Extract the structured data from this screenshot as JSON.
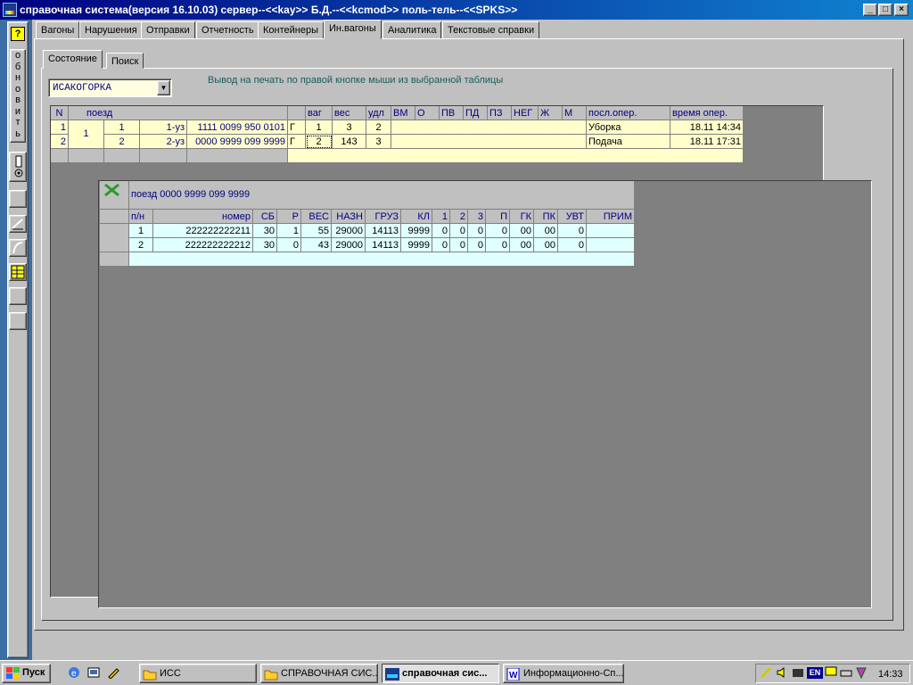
{
  "window": {
    "title": "справочная система(версия 16.10.03) сервер--<<kay>> Б.Д.--<<kcmod>> поль-тель--<<SPKS>>"
  },
  "leftbar": {
    "help": "?",
    "refresh_text": "о\nб\nн\nо\nв\nи\nт\nь"
  },
  "tabs": [
    "Вагоны",
    "Нарушения",
    "Отправки",
    "Отчетность",
    "Контейнеры",
    "Ин.вагоны",
    "Аналитика",
    "Текстовые справки"
  ],
  "subtabs": [
    "Состояние",
    "Поиск"
  ],
  "station": {
    "value": "ИСАКОГОРКА"
  },
  "hint": "Вывод на печать по правой кнопке мыши из выбранной таблицы",
  "grid1": {
    "headers": {
      "n": "N",
      "train": "поезд",
      "vag": "ваг",
      "ves": "вес",
      "udl": "удл",
      "vm": "ВМ",
      "o": "О",
      "pv": "ПВ",
      "pd": "ПД",
      "pz": "ПЗ",
      "neg": "НЕГ",
      "zh": "Ж",
      "m": "М",
      "posl": "посл.опер.",
      "time": "время опер."
    },
    "group": "1",
    "rows": [
      {
        "n": "1",
        "c1": "1",
        "c2": "1-уз",
        "index": "1111 0099 950 0101",
        "g": "Г",
        "vag": "1",
        "ves": "3",
        "udl": "2",
        "posl": "Уборка",
        "time": "18.11 14:34"
      },
      {
        "n": "2",
        "c1": "2",
        "c2": "2-уз",
        "index": "0000 9999 099 9999",
        "g": "Г",
        "vag": "2",
        "ves": "143",
        "udl": "3",
        "posl": "Подача",
        "time": "18.11 17:31"
      }
    ]
  },
  "grid2": {
    "title": "поезд 0000 9999 099 9999",
    "headers": {
      "pn": "п/н",
      "nomer": "номер",
      "sb": "СБ",
      "r": "Р",
      "ves": "ВЕС",
      "nazn": "НАЗН",
      "gruz": "ГРУЗ",
      "kl": "КЛ",
      "h1": "1",
      "h2": "2",
      "h3": "3",
      "p": "П",
      "gk": "ГК",
      "pk": "ПК",
      "uvt": "УВТ",
      "prim": "ПРИМ"
    },
    "rows": [
      {
        "pn": "1",
        "nomer": "222222222211",
        "sb": "30",
        "r": "1",
        "ves": "55",
        "nazn": "29000",
        "gruz": "14113",
        "kl": "9999",
        "h1": "0",
        "h2": "0",
        "h3": "0",
        "p": "0",
        "gk": "00",
        "pk": "00",
        "uvt": "0"
      },
      {
        "pn": "2",
        "nomer": "222222222212",
        "sb": "30",
        "r": "0",
        "ves": "43",
        "nazn": "29000",
        "gruz": "14113",
        "kl": "9999",
        "h1": "0",
        "h2": "0",
        "h3": "0",
        "p": "0",
        "gk": "00",
        "pk": "00",
        "uvt": "0"
      }
    ]
  },
  "taskbar": {
    "start": "Пуск",
    "tasks": [
      "ИСС",
      "СПРАВОЧНАЯ СИС...",
      "справочная сис...",
      "Информационно-Сп..."
    ],
    "clock": "14:33",
    "lang": "EN"
  }
}
